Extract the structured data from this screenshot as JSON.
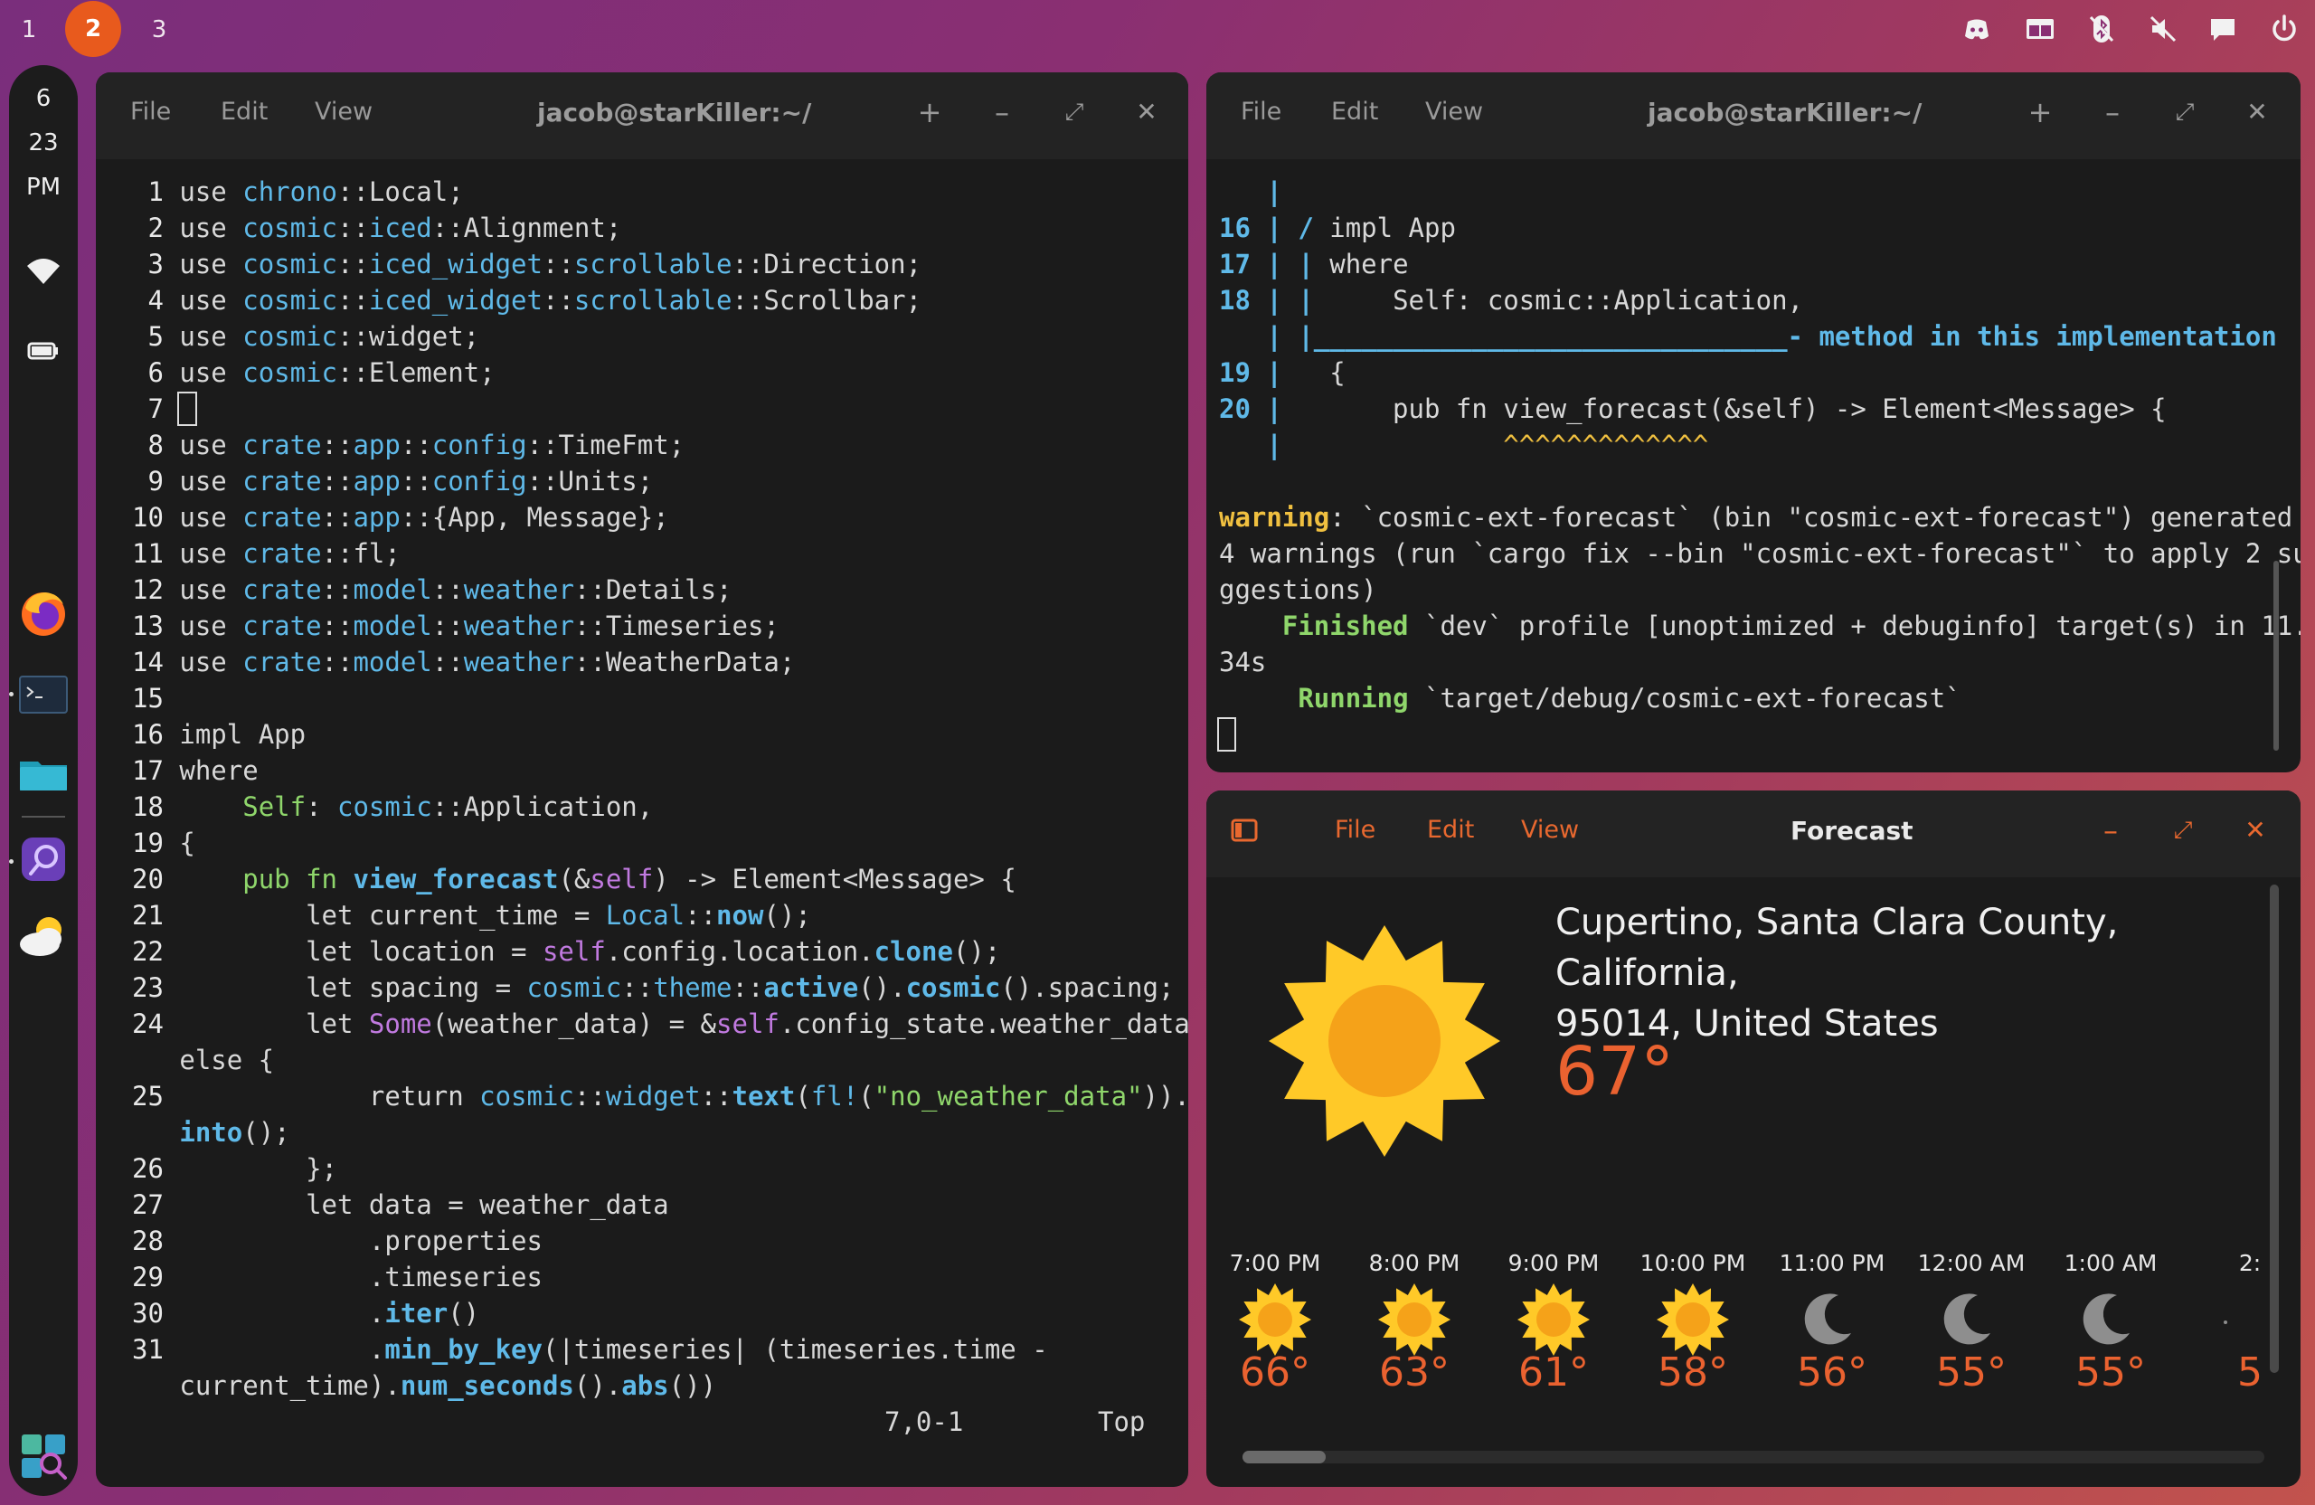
{
  "top_panel": {
    "workspaces": [
      "1",
      "2",
      "3"
    ],
    "active_workspace": "2",
    "tray_icons": [
      "discord-icon",
      "window-tiling-icon",
      "bluetooth-off-icon",
      "volume-muted-icon",
      "notifications-icon",
      "power-icon"
    ]
  },
  "dock": {
    "clock": {
      "hour": "6",
      "minute": "23",
      "ampm": "PM"
    },
    "status_icons": [
      "wifi-icon",
      "battery-icon"
    ],
    "apps": [
      "firefox-icon",
      "terminal-icon",
      "files-icon",
      "app-icon",
      "weather-app-icon",
      "app-library-icon"
    ]
  },
  "editor_window": {
    "menu": [
      "File",
      "Edit",
      "View"
    ],
    "title": "jacob@starKiller:~/",
    "status_position": "7,0-1",
    "status_scroll": "Top"
  },
  "terminal_window": {
    "menu": [
      "File",
      "Edit",
      "View"
    ],
    "title": "jacob@starKiller:~/"
  },
  "forecast_window": {
    "menu": [
      "File",
      "Edit",
      "View"
    ],
    "title": "Forecast",
    "location_line1": "Cupertino, Santa Clara County, California,",
    "location_line2": "95014, United States",
    "current_temp": "67°",
    "hourly": [
      {
        "time": "7:00 PM",
        "icon": "sun-icon",
        "temp": "66°"
      },
      {
        "time": "8:00 PM",
        "icon": "sun-icon",
        "temp": "63°"
      },
      {
        "time": "9:00 PM",
        "icon": "sun-icon",
        "temp": "61°"
      },
      {
        "time": "10:00 PM",
        "icon": "sun-icon",
        "temp": "58°"
      },
      {
        "time": "11:00 PM",
        "icon": "moon-icon",
        "temp": "56°"
      },
      {
        "time": "12:00 AM",
        "icon": "moon-icon",
        "temp": "55°"
      },
      {
        "time": "1:00 AM",
        "icon": "moon-icon",
        "temp": "55°"
      },
      {
        "time": "2:",
        "icon": "partial-icon",
        "temp": "5"
      }
    ]
  },
  "colors": {
    "accent": "#e85a1d",
    "forecast_temp": "#ea6230",
    "window_bg": "#1b1b1b",
    "headerbar": "#232323"
  }
}
